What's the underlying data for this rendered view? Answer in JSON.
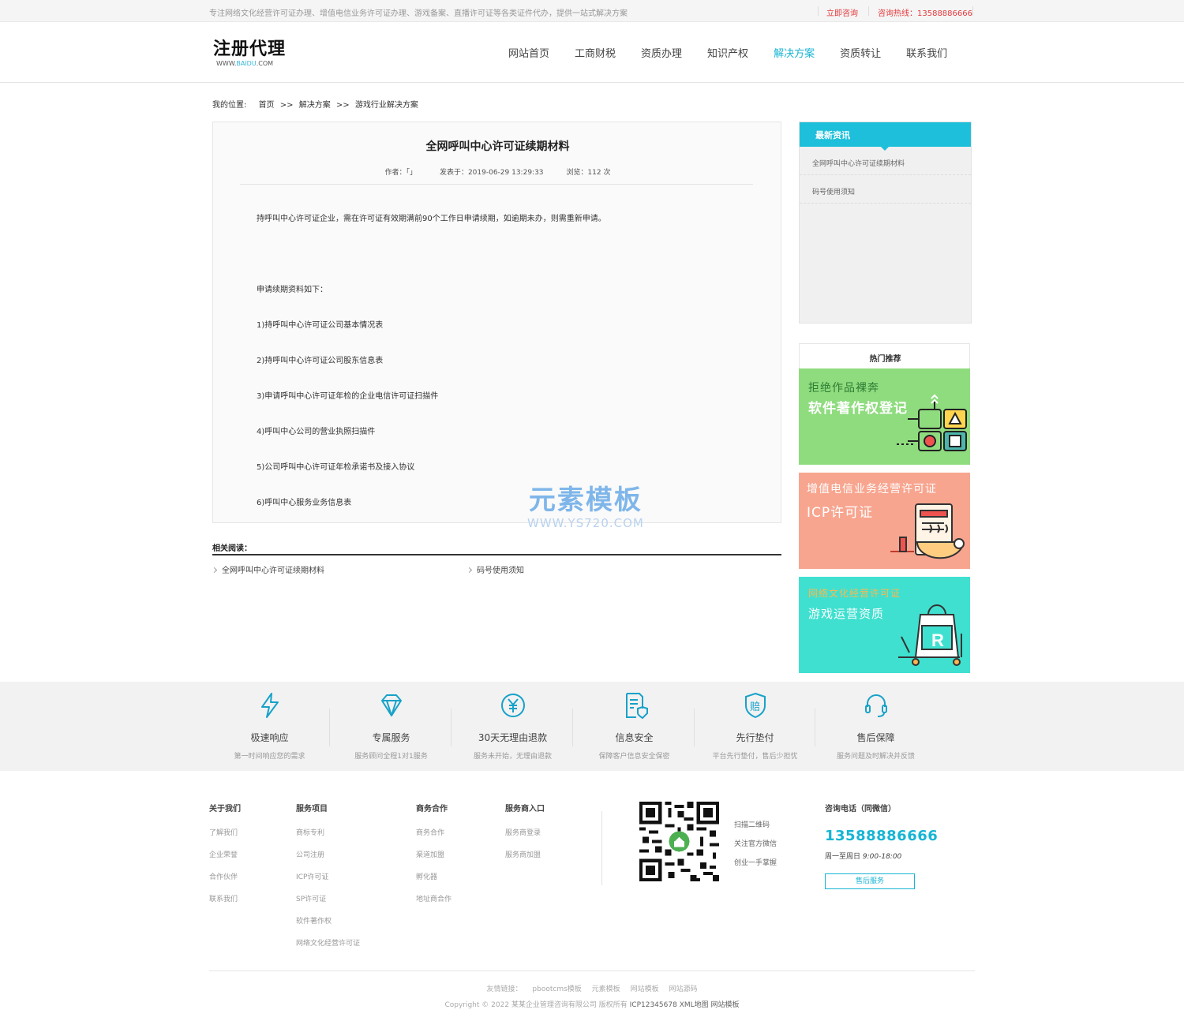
{
  "topbar": {
    "intro": "专注网络文化经营许可证办理、增值电信业务许可证办理、游戏备案、直播许可证等各类证件代办，提供一站式解决方案",
    "consult": "立即咨询",
    "hotline": "咨询热线：13588886666"
  },
  "header": {
    "logo_text": "注册代理",
    "logo_domain_pre": "WWW.",
    "logo_domain_acc": "BAIDU",
    "logo_domain_post": ".COM",
    "nav": [
      "网站首页",
      "工商财税",
      "资质办理",
      "知识产权",
      "解决方案",
      "资质转让",
      "联系我们"
    ],
    "active_nav": "解决方案",
    "active_color": "#17b4d4"
  },
  "breadcrumb": {
    "label": "我的位置:",
    "home": "首页",
    "sep": ">>",
    "cat": "解决方案",
    "sub": "游戏行业解决方案"
  },
  "article": {
    "title": "全网呼叫中心许可证续期材料",
    "author": "作者：「」",
    "published": "发表于：2019-06-29 13:29:33",
    "views": "浏览：112 次",
    "paragraphs": [
      "持呼叫中心许可证企业，需在许可证有效期满前90个工作日申请续期，如逾期未办，则需重新申请。",
      "申请续期资料如下：",
      "1)持呼叫中心许可证公司基本情况表",
      "2)持呼叫中心许可证公司股东信息表",
      "3)申请呼叫中心许可证年检的企业电信许可证扫描件",
      "4)呼叫中心公司的营业执照扫描件",
      "5)公司呼叫中心许可证年检承诺书及接入协议",
      "6)呼叫中心服务业务信息表"
    ]
  },
  "watermark": {
    "big": "元素模板",
    "small": "WWW.YS720.COM"
  },
  "related": {
    "title": "相关阅读：",
    "items": [
      "全网呼叫中心许可证续期材料",
      "码号使用须知"
    ]
  },
  "sidebar": {
    "news_title": "最新资讯",
    "news_items": [
      "全网呼叫中心许可证续期材料",
      "码号使用须知"
    ],
    "hot_title": "热门推荐",
    "banners": [
      {
        "line1": "拒绝作品裸奔",
        "line2": "软件著作权登记",
        "bg": "#8fdc7f",
        "c1": "#2e7d32",
        "c2": "#ffffff"
      },
      {
        "line1": "增值电信业务经营许可证",
        "line2": "ICP许可证",
        "bg": "#f8a58f",
        "c1": "#ffffff",
        "c2": "#ffffff"
      },
      {
        "line1": "网络文化经营许可证",
        "line2": "游戏运营资质",
        "bg": "#3fe0cf",
        "c1": "#ffb74d",
        "c2": "#ffffff"
      }
    ]
  },
  "features": [
    {
      "title": "极速响应",
      "sub": "第一时间响应您的需求",
      "icon": "lightning-icon"
    },
    {
      "title": "专属服务",
      "sub": "服务顾问全程1对1服务",
      "icon": "diamond-icon"
    },
    {
      "title": "30天无理由退款",
      "sub": "服务未开始，无理由退款",
      "icon": "yuan-refund-icon"
    },
    {
      "title": "信息安全",
      "sub": "保障客户信息安全保密",
      "icon": "document-shield-icon"
    },
    {
      "title": "先行垫付",
      "sub": "平台先行垫付，售后少担忧",
      "icon": "compensation-shield-icon"
    },
    {
      "title": "售后保障",
      "sub": "服务问题及时解决并反馈",
      "icon": "headset-icon"
    }
  ],
  "footer": {
    "columns": [
      {
        "title": "关于我们",
        "items": [
          "了解我们",
          "企业荣誉",
          "合作伙伴",
          "联系我们"
        ]
      },
      {
        "title": "服务项目",
        "items": [
          "商标专利",
          "公司注册",
          "ICP许可证",
          "SP许可证",
          "软件著作权",
          "网络文化经营许可证"
        ]
      },
      {
        "title": "商务合作",
        "items": [
          "商务合作",
          "渠道加盟",
          "孵化器",
          "地址商合作"
        ]
      },
      {
        "title": "服务商入口",
        "items": [
          "服务商登录",
          "服务商加盟"
        ]
      }
    ],
    "qr_text": [
      "扫描二维码",
      "关注官方微信",
      "创业一手掌握"
    ],
    "contact_title": "咨询电话（同微信）",
    "phone": "13588886666",
    "hours_pre": "周一至周日",
    "hours_time": "9:00-18:00",
    "after_sale": "售后服务",
    "links_label": "友情链接：",
    "links": [
      "pbootcms模板",
      "元素模板",
      "网站模板",
      "网站源码"
    ],
    "copyright": "Copyright © 2022 某某企业管理咨询有限公司 版权所有",
    "icp": "ICP12345678",
    "xml": "XML地图",
    "tpl": "网站模板"
  }
}
